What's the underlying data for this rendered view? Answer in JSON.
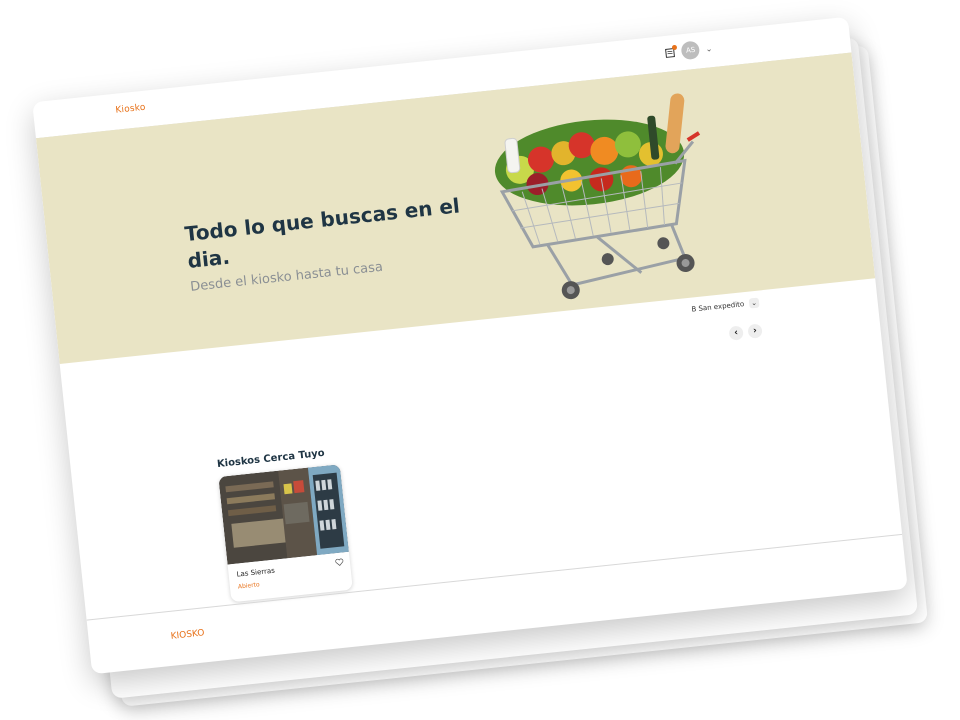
{
  "header": {
    "logo": "Kiosko",
    "avatar_initials": "AS"
  },
  "hero": {
    "title": "Todo lo que buscas en el dia.",
    "subtitle": "Desde el kiosko hasta tu casa"
  },
  "location": {
    "selected": "B San expedito"
  },
  "section": {
    "title": "Kioskos Cerca Tuyo"
  },
  "cards": [
    {
      "name": "Las Sierras",
      "status": "Abierto"
    }
  ],
  "footer": {
    "logo": "KIOSKO"
  },
  "colors": {
    "accent": "#e8731c",
    "hero_bg": "#e9e4c5",
    "heading": "#1f3544"
  }
}
